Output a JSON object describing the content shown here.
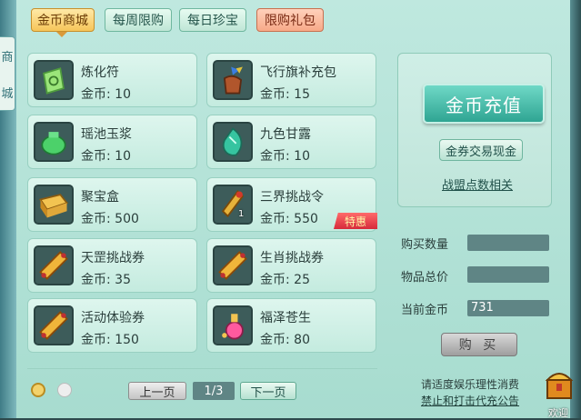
{
  "side_tab": {
    "chars": [
      "商",
      "城"
    ]
  },
  "tabs": [
    {
      "label": "金币商城",
      "state": "active"
    },
    {
      "label": "每周限购",
      "state": "normal"
    },
    {
      "label": "每日珍宝",
      "state": "normal"
    },
    {
      "label": "限购礼包",
      "state": "special"
    }
  ],
  "items": [
    {
      "name": "炼化符",
      "price": "金币: 10",
      "icon": "talisman-icon"
    },
    {
      "name": "飞行旗补充包",
      "price": "金币: 15",
      "icon": "flag-pack-icon"
    },
    {
      "name": "瑶池玉浆",
      "price": "金币: 10",
      "icon": "jade-jar-icon"
    },
    {
      "name": "九色甘露",
      "price": "金币: 10",
      "icon": "dew-gem-icon"
    },
    {
      "name": "聚宝盒",
      "price": "金币: 500",
      "icon": "treasure-box-icon"
    },
    {
      "name": "三界挑战令",
      "price": "金币: 550",
      "icon": "challenge-token-icon",
      "qty": "1",
      "badge": "特惠"
    },
    {
      "name": "天罡挑战券",
      "price": "金币: 35",
      "icon": "scroll-icon"
    },
    {
      "name": "生肖挑战券",
      "price": "金币: 25",
      "icon": "scroll-icon"
    },
    {
      "name": "活动体验券",
      "price": "金币: 150",
      "icon": "scroll-icon"
    },
    {
      "name": "福泽苍生",
      "price": "金币: 80",
      "icon": "potion-icon"
    }
  ],
  "panel": {
    "recharge_label": "金币充值",
    "exchange_label": "金券交易现金",
    "alliance_label": "战盟点数相关"
  },
  "purchase": {
    "qty_label": "购买数量",
    "qty_value": "",
    "total_label": "物品总价",
    "total_value": "",
    "current_label": "当前金币",
    "current_value": "731",
    "buy_label": "购 买"
  },
  "pager": {
    "prev": "上一页",
    "page": "1/3",
    "next": "下一页"
  },
  "notice": {
    "line1": "请适度娱乐理性消费",
    "line2": "禁止和打击代充公告"
  },
  "welcome": "欢迎",
  "colors": {
    "accent": "#f6c55a",
    "background": "#bfe8df",
    "field": "#5f8585"
  }
}
